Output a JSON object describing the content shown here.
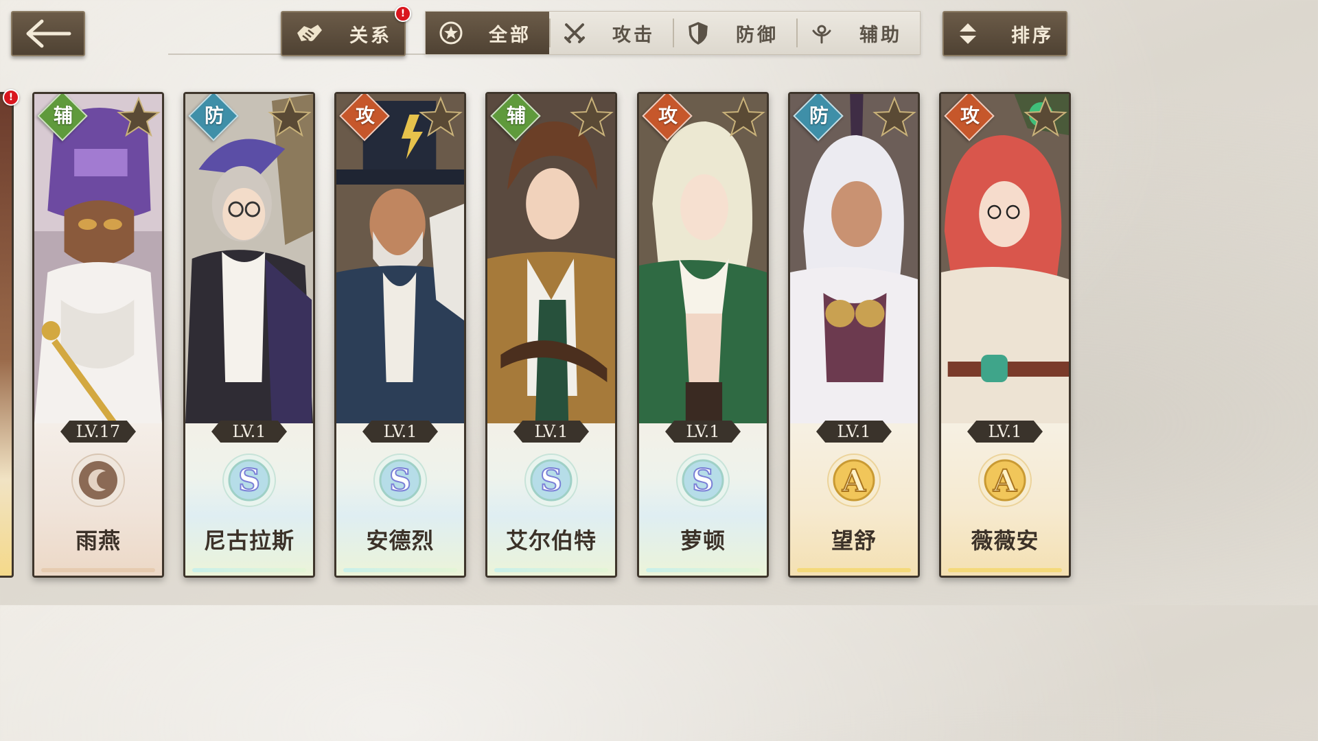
{
  "header": {
    "back_icon": "arrow-left-icon",
    "relations_label": "关系",
    "relations_badge": "!",
    "sort_label": "排序",
    "tabs": [
      {
        "label": "全部",
        "icon": "star-circle-icon",
        "active": true
      },
      {
        "label": "攻击",
        "icon": "crossed-swords-icon",
        "active": false
      },
      {
        "label": "防御",
        "icon": "shield-icon",
        "active": false
      },
      {
        "label": "辅助",
        "icon": "support-icon",
        "active": false
      }
    ]
  },
  "edge_card_badge": "!",
  "characters": [
    {
      "name": "雨燕",
      "level": "LV.17",
      "type": "辅",
      "rank": "",
      "rank_icon": "locked-rank-icon"
    },
    {
      "name": "尼古拉斯",
      "level": "LV.1",
      "type": "防",
      "rank": "S"
    },
    {
      "name": "安德烈",
      "level": "LV.1",
      "type": "攻",
      "rank": "S"
    },
    {
      "name": "艾尔伯特",
      "level": "LV.1",
      "type": "辅",
      "rank": "S"
    },
    {
      "name": "萝顿",
      "level": "LV.1",
      "type": "攻",
      "rank": "S"
    },
    {
      "name": "望舒",
      "level": "LV.1",
      "type": "防",
      "rank": "A"
    },
    {
      "name": "薇薇安",
      "level": "LV.1",
      "type": "攻",
      "rank": "A"
    }
  ],
  "colors": {
    "support": "#5f9a3c",
    "defense": "#3f8fa8",
    "attack": "#c6572b",
    "button_dark": "#5a4b3a",
    "badge_red": "#d9161e"
  }
}
